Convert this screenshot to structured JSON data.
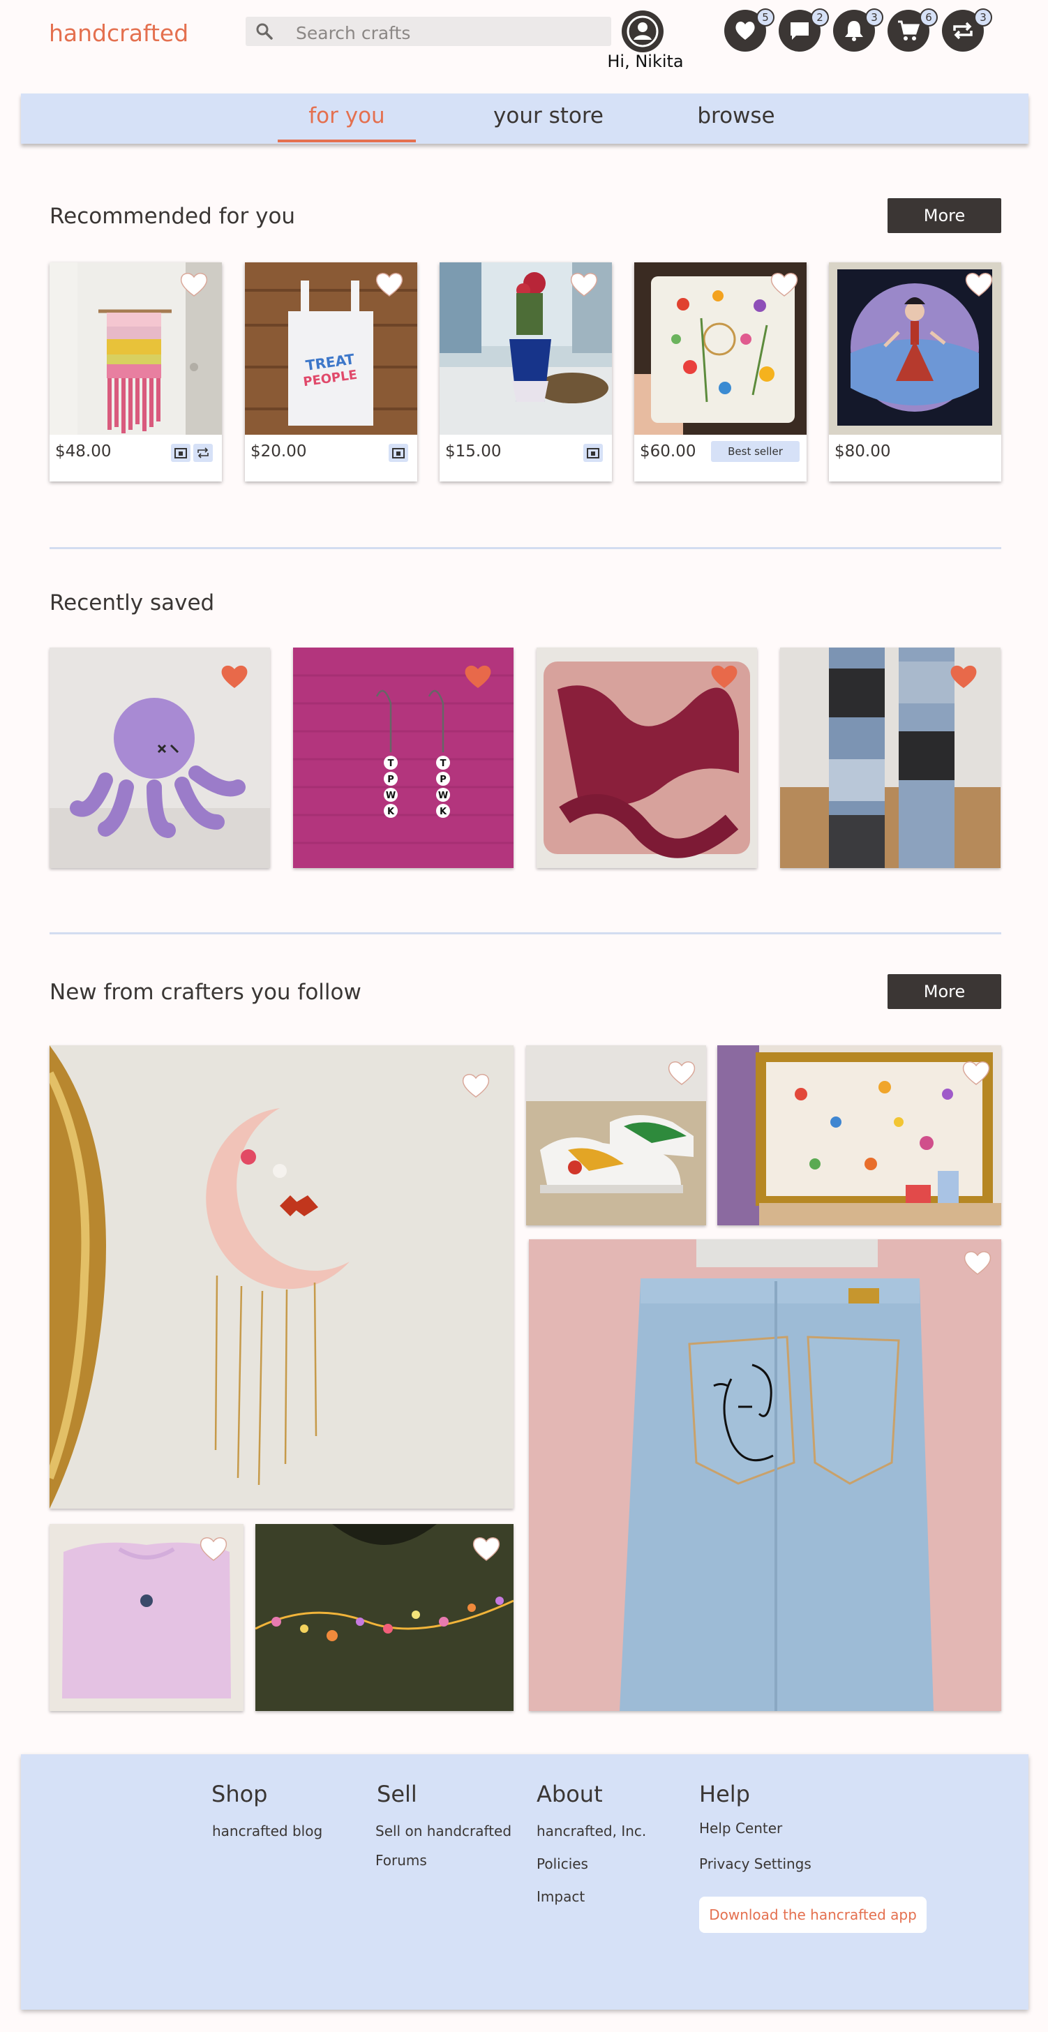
{
  "header": {
    "logo": "handcrafted",
    "search_placeholder": "Search crafts",
    "greeting": "Hi, Nikita",
    "icons": [
      {
        "name": "favorites-icon",
        "badge": "5"
      },
      {
        "name": "messages-icon",
        "badge": "2"
      },
      {
        "name": "notifications-icon",
        "badge": "3"
      },
      {
        "name": "cart-icon",
        "badge": "6"
      },
      {
        "name": "swaps-icon",
        "badge": "3"
      }
    ]
  },
  "tabs": [
    {
      "label": "for you",
      "active": true
    },
    {
      "label": "your store",
      "active": false
    },
    {
      "label": "browse",
      "active": false
    }
  ],
  "recommended": {
    "title": "Recommended for you",
    "more": "More",
    "items": [
      {
        "price": "$48.00",
        "tags": [
          "camera-icon",
          "swap-icon"
        ]
      },
      {
        "price": "$20.00",
        "tags": [
          "camera-icon"
        ]
      },
      {
        "price": "$15.00",
        "tags": [
          "camera-icon"
        ]
      },
      {
        "price": "$60.00",
        "badge": "Best seller"
      },
      {
        "price": "$80.00"
      }
    ]
  },
  "saved": {
    "title": "Recently saved"
  },
  "following": {
    "title": "New from crafters you follow",
    "more": "More"
  },
  "footer": {
    "shop": {
      "title": "Shop",
      "links": [
        "hancrafted blog"
      ]
    },
    "sell": {
      "title": "Sell",
      "links": [
        "Sell on handcrafted",
        "Forums"
      ]
    },
    "about": {
      "title": "About",
      "links": [
        "hancrafted, Inc.",
        "Policies",
        "Impact"
      ]
    },
    "help": {
      "title": "Help",
      "links": [
        "Help Center",
        "Privacy Settings"
      ],
      "app_button": "Download the hancrafted app"
    }
  },
  "colors": {
    "accent": "#e4704f",
    "panel": "#d6e1f7",
    "dark": "#3b3634"
  }
}
